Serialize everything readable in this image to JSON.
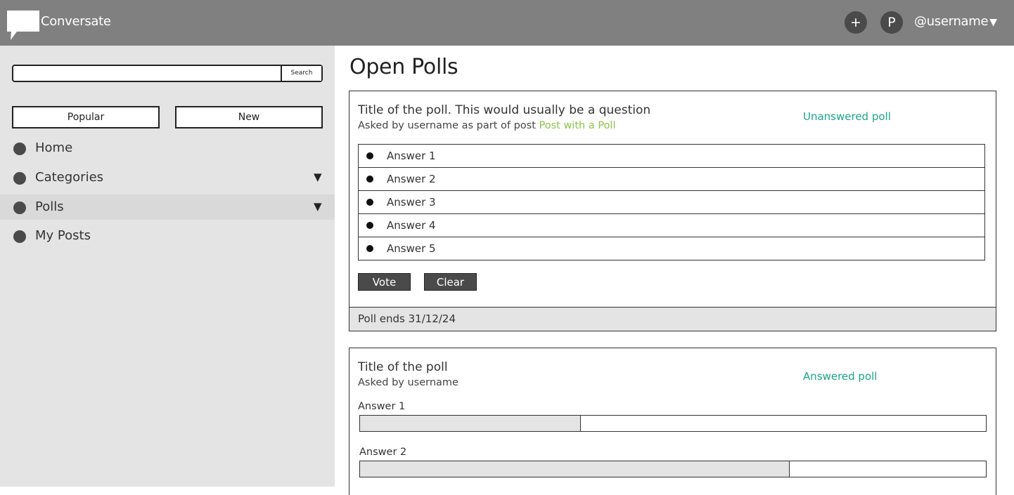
{
  "header": {
    "app_title": "Conversate",
    "add_label": "+",
    "profile_initial": "P",
    "username": "@username",
    "caret": "▼"
  },
  "sidebar": {
    "search": {
      "value": "",
      "placeholder": "",
      "button_label": "Search"
    },
    "filters": {
      "popular_label": "Popular",
      "new_label": "New"
    },
    "nav": [
      {
        "label": "Home",
        "caret": ""
      },
      {
        "label": "Categories",
        "caret": "▼"
      },
      {
        "label": "Polls",
        "caret": "▼",
        "active": true
      },
      {
        "label": "My Posts",
        "caret": ""
      }
    ]
  },
  "main": {
    "page_title": "Open Polls",
    "polls": [
      {
        "title": "Title of the poll. This would usually be a question",
        "asked_by_prefix": "Asked by username as part of post ",
        "post_link": "Post with a Poll",
        "status": "Unanswered poll",
        "answers": [
          "Answer 1",
          "Answer 2",
          "Answer 3",
          "Answer 4",
          "Answer 5"
        ],
        "vote_label": "Vote",
        "clear_label": "Clear",
        "ends": "Poll ends 31/12/24"
      },
      {
        "title": "Title of the poll",
        "asked_by": "Asked by username",
        "status": "Answered poll",
        "results": [
          {
            "label": "Answer 1",
            "fraction": 0.353
          },
          {
            "label": "Answer 2",
            "fraction": 0.687
          }
        ]
      }
    ]
  },
  "colors": {
    "topbar": "#808080",
    "sidebar": "#e4e4e4",
    "status_green": "#1aa58a",
    "link_green": "#8bc34a",
    "button_dark": "#4a4a4a"
  }
}
